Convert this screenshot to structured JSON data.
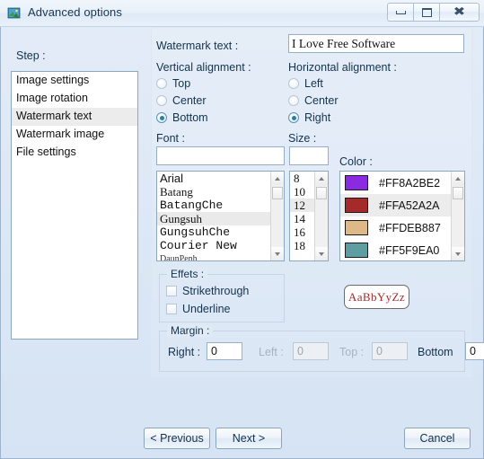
{
  "window": {
    "title": "Advanced options",
    "icon": "image-watermark-icon",
    "controls": {
      "minimize": "minimize-icon",
      "maximize": "maximize-icon",
      "close": "close-icon"
    }
  },
  "step": {
    "label": "Step :",
    "items": [
      {
        "label": "Image settings",
        "selected": false
      },
      {
        "label": "Image rotation",
        "selected": false
      },
      {
        "label": "Watermark text",
        "selected": true
      },
      {
        "label": "Watermark image",
        "selected": false
      },
      {
        "label": "File settings",
        "selected": false
      }
    ]
  },
  "watermark": {
    "text_label": "Watermark text :",
    "text_value": "I Love Free Software",
    "text_placeholder": ""
  },
  "vertical_alignment": {
    "label": "Vertical alignment :",
    "options": [
      {
        "label": "Top",
        "selected": false
      },
      {
        "label": "Center",
        "selected": false
      },
      {
        "label": "Bottom",
        "selected": true
      }
    ]
  },
  "horizontal_alignment": {
    "label": "Horizontal alignment :",
    "options": [
      {
        "label": "Left",
        "selected": false
      },
      {
        "label": "Center",
        "selected": false
      },
      {
        "label": "Right",
        "selected": true
      }
    ]
  },
  "font": {
    "label": "Font :",
    "input_value": "",
    "items": [
      {
        "label": "Arial",
        "selected": false
      },
      {
        "label": "Batang",
        "selected": false
      },
      {
        "label": "BatangChe",
        "selected": false
      },
      {
        "label": "Gungsuh",
        "selected": true
      },
      {
        "label": "GungsuhChe",
        "selected": false
      },
      {
        "label": "Courier New",
        "selected": false
      },
      {
        "label": "DaunPenh",
        "selected": false
      }
    ]
  },
  "size": {
    "label": "Size :",
    "input_value": "",
    "items": [
      {
        "label": "8",
        "selected": false
      },
      {
        "label": "10",
        "selected": false
      },
      {
        "label": "12",
        "selected": true
      },
      {
        "label": "14",
        "selected": false
      },
      {
        "label": "16",
        "selected": false
      },
      {
        "label": "18",
        "selected": false
      }
    ]
  },
  "color": {
    "label": "Color :",
    "items": [
      {
        "hex": "#FF8A2BE2",
        "swatch": "#8a2be2",
        "selected": false
      },
      {
        "hex": "#FFA52A2A",
        "swatch": "#a52a2a",
        "selected": true
      },
      {
        "hex": "#FFDEB887",
        "swatch": "#deb887",
        "selected": false
      },
      {
        "hex": "#FF5F9EA0",
        "swatch": "#5f9ea0",
        "selected": false
      }
    ]
  },
  "effects": {
    "label": "Effets :",
    "options": [
      {
        "label": "Strikethrough",
        "checked": false
      },
      {
        "label": "Underline",
        "checked": false
      }
    ]
  },
  "preview": {
    "text": "AaBbYyZz",
    "color": "#a52a2a"
  },
  "margin": {
    "label": "Margin :",
    "fields": [
      {
        "label": "Right :",
        "value": "0",
        "enabled": true
      },
      {
        "label": "Left :",
        "value": "0",
        "enabled": false
      },
      {
        "label": "Top :",
        "value": "0",
        "enabled": false
      },
      {
        "label": "Bottom",
        "value": "0",
        "enabled": true
      }
    ]
  },
  "buttons": {
    "previous": "< Previous",
    "next": "Next >",
    "cancel": "Cancel"
  }
}
